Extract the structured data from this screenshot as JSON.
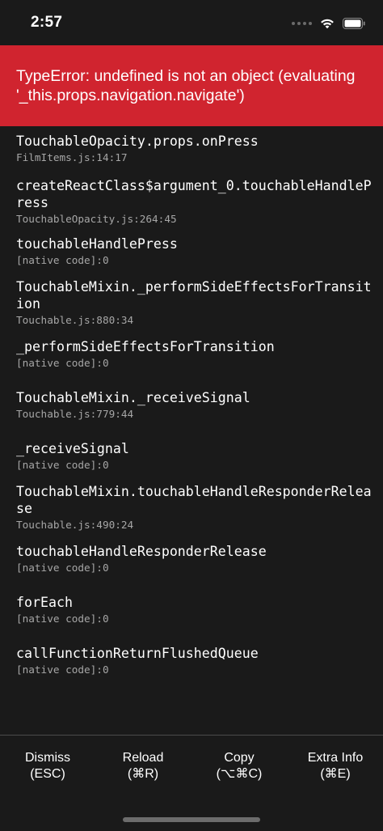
{
  "status_bar": {
    "time": "2:57"
  },
  "error": {
    "message": "TypeError: undefined is not an object (evaluating '_this.props.navigation.navigate')",
    "header_color": "#d0242f"
  },
  "stack": [
    {
      "method": "TouchableOpacity.props.onPress",
      "location": "FilmItems.js:14:17"
    },
    {
      "method": "createReactClass$argument_0.touchableHandlePress",
      "location": "TouchableOpacity.js:264:45"
    },
    {
      "method": "touchableHandlePress",
      "location": "[native code]:0"
    },
    {
      "method": "TouchableMixin._performSideEffectsForTransition",
      "location": "Touchable.js:880:34"
    },
    {
      "method": "_performSideEffectsForTransition",
      "location": "[native code]:0"
    },
    {
      "method": "TouchableMixin._receiveSignal",
      "location": "Touchable.js:779:44"
    },
    {
      "method": "_receiveSignal",
      "location": "[native code]:0"
    },
    {
      "method": "TouchableMixin.touchableHandleResponderRelease",
      "location": "Touchable.js:490:24"
    },
    {
      "method": "touchableHandleResponderRelease",
      "location": "[native code]:0"
    },
    {
      "method": "forEach",
      "location": "[native code]:0"
    },
    {
      "method": "callFunctionReturnFlushedQueue",
      "location": "[native code]:0"
    }
  ],
  "actions": {
    "dismiss": {
      "label": "Dismiss",
      "shortcut": "(ESC)"
    },
    "reload": {
      "label": "Reload",
      "shortcut": "(⌘R)"
    },
    "copy": {
      "label": "Copy",
      "shortcut": "(⌥⌘C)"
    },
    "extra_info": {
      "label": "Extra Info",
      "shortcut": "(⌘E)"
    }
  },
  "icons": {
    "signal": "cellular-signal-icon",
    "wifi": "wifi-icon",
    "battery": "battery-icon"
  }
}
